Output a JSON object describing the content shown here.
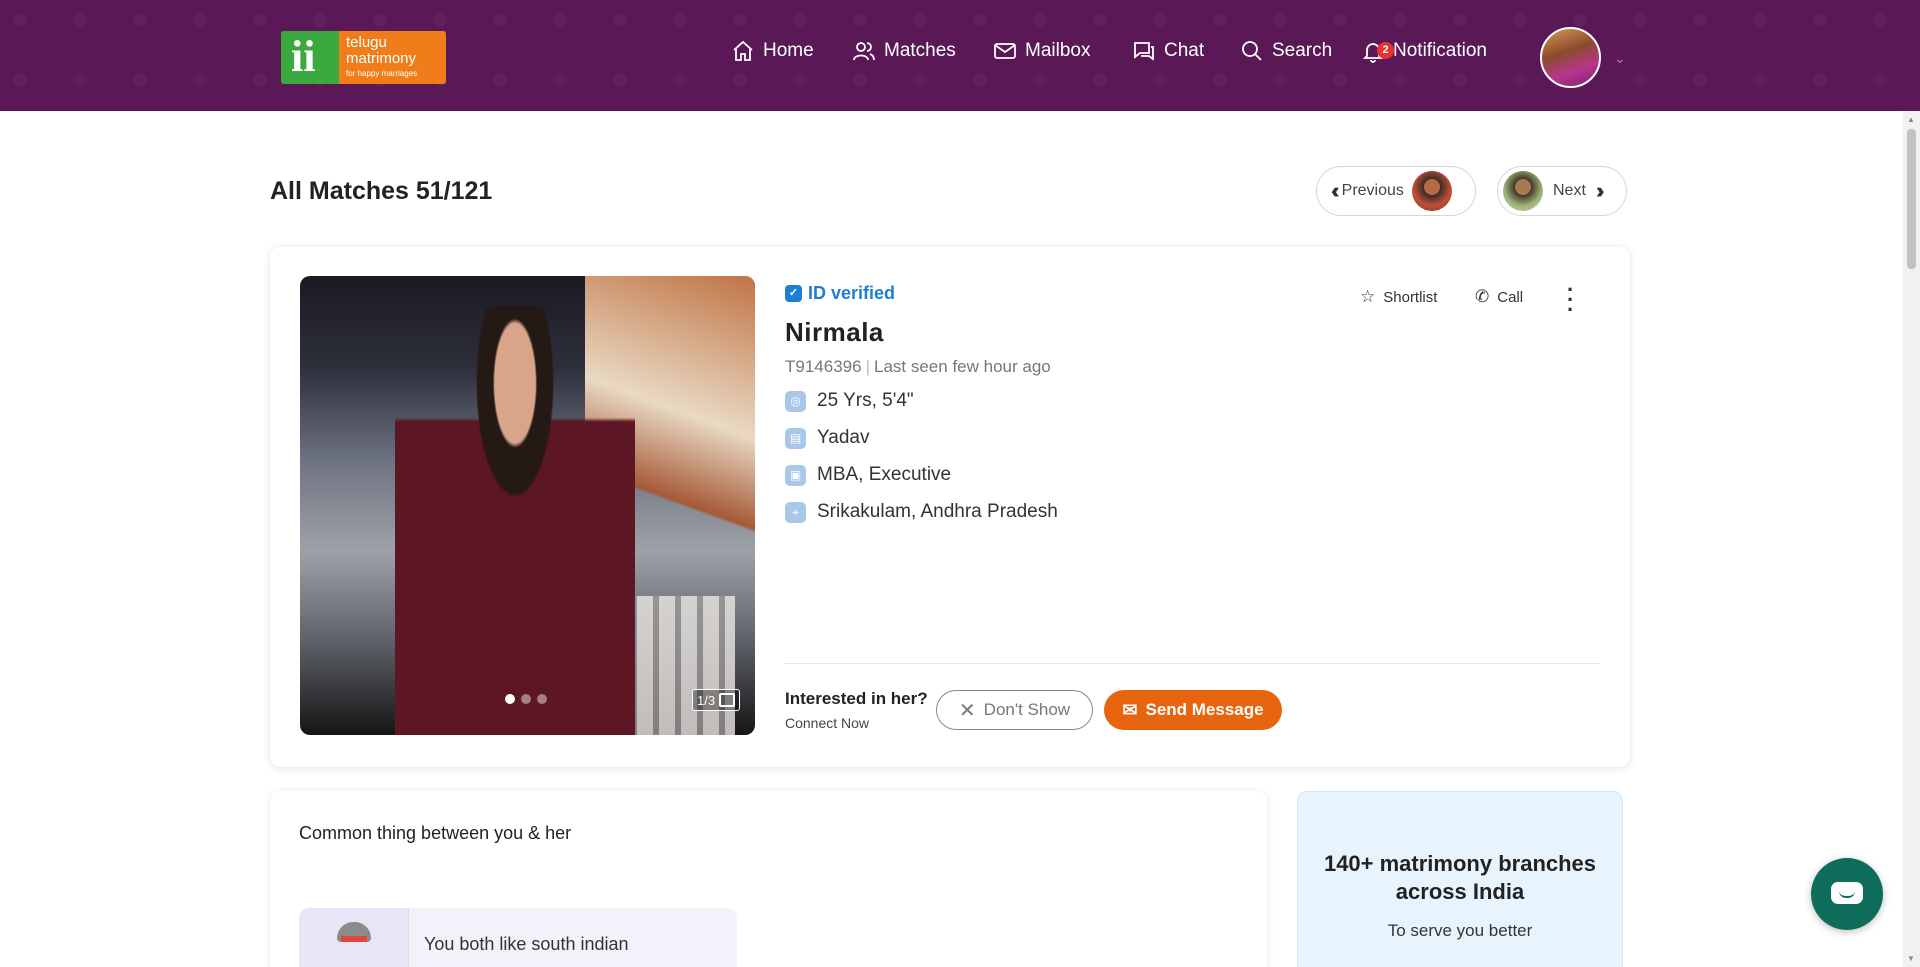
{
  "logo": {
    "line1": "telugu",
    "line2": "matrimony",
    "tagline": "for happy marriages"
  },
  "nav": {
    "home": "Home",
    "matches": "Matches",
    "mailbox": "Mailbox",
    "chat": "Chat",
    "search": "Search",
    "notification": "Notification",
    "notification_count": "2"
  },
  "page": {
    "title": "All Matches 51/121",
    "previous": "Previous",
    "next": "Next"
  },
  "profile": {
    "verified": "ID verified",
    "name": "Nirmala",
    "id": "T9146396",
    "last_seen": "Last seen few hour ago",
    "age_height": "25 Yrs, 5'4\"",
    "caste": "Yadav",
    "education_job": "MBA, Executive",
    "location": "Srikakulam, Andhra Pradesh",
    "photo_count": "1/3",
    "shortlist": "Shortlist",
    "call": "Call"
  },
  "interest": {
    "question": "Interested in her?",
    "sub": "Connect Now",
    "dont_show": "Don't Show",
    "send_message": "Send Message"
  },
  "common": {
    "title": "Common thing between you & her",
    "item": "You both like south indian"
  },
  "branches": {
    "title": "140+ matrimony branches across India",
    "sub": "To serve you better"
  },
  "colors": {
    "header_bg": "#5b1856",
    "accent_orange": "#e8650f",
    "verified_blue": "#1e7fd4",
    "chat_fab": "#0e6c5b"
  }
}
